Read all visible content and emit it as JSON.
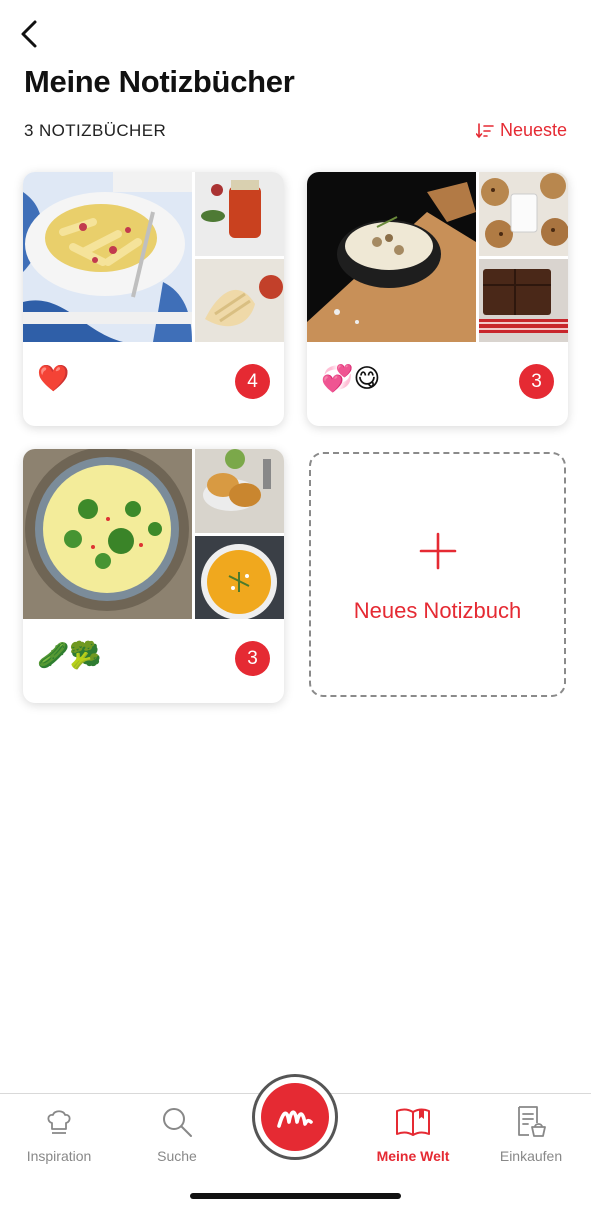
{
  "header": {
    "back_icon": "chevron-left-icon",
    "title": "Meine Notizbücher",
    "count_label": "3 NOTIZBÜCHER",
    "sort_label": "Neueste",
    "sort_icon": "sort-icon"
  },
  "notebooks": [
    {
      "emoji": "❤️",
      "count": "4",
      "images": [
        "pasta-dish-photo",
        "tomato-sauce-jar-photo",
        "fresh-pasta-photo"
      ]
    },
    {
      "emoji": "💞😋",
      "count": "3",
      "images": [
        "risotto-pan-photo",
        "cookies-milk-photo",
        "brownies-photo"
      ]
    },
    {
      "emoji": "🥒🥦",
      "count": "3",
      "images": [
        "broccoli-soup-photo",
        "potato-fritters-photo",
        "pumpkin-soup-photo"
      ]
    }
  ],
  "new_notebook": {
    "label": "Neues Notizbuch",
    "icon": "plus-icon"
  },
  "tabbar": {
    "tabs": [
      {
        "label": "Inspiration",
        "icon": "chef-hat-icon"
      },
      {
        "label": "Suche",
        "icon": "search-icon"
      },
      {
        "label": "Meine Welt",
        "icon": "book-icon",
        "active": true
      },
      {
        "label": "Einkaufen",
        "icon": "shopping-list-icon"
      }
    ],
    "center_icon": "app-logo-icon"
  },
  "colors": {
    "accent": "#e52a33",
    "badge": "#e52a33",
    "tab_inactive": "#888888"
  }
}
